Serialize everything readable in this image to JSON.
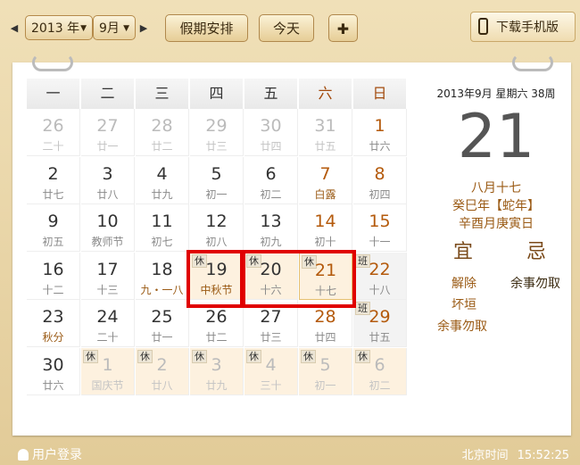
{
  "toolbar": {
    "year": "2013 年",
    "month": "9月",
    "holiday_btn": "假期安排",
    "today_btn": "今天",
    "add_btn": "✚",
    "mobile_btn": "下载手机版"
  },
  "weekdays": [
    "一",
    "二",
    "三",
    "四",
    "五",
    "六",
    "日"
  ],
  "weeks": [
    [
      {
        "d": "26",
        "s": "二十",
        "cls": "other"
      },
      {
        "d": "27",
        "s": "廿一",
        "cls": "other"
      },
      {
        "d": "28",
        "s": "廿二",
        "cls": "other"
      },
      {
        "d": "29",
        "s": "廿三",
        "cls": "other"
      },
      {
        "d": "30",
        "s": "廿四",
        "cls": "other"
      },
      {
        "d": "31",
        "s": "廿五",
        "cls": "other"
      },
      {
        "d": "1",
        "s": "廿六",
        "cls": "weekend"
      }
    ],
    [
      {
        "d": "2",
        "s": "廿七"
      },
      {
        "d": "3",
        "s": "廿八"
      },
      {
        "d": "4",
        "s": "廿九"
      },
      {
        "d": "5",
        "s": "初一"
      },
      {
        "d": "6",
        "s": "初二"
      },
      {
        "d": "7",
        "s": "白露",
        "cls": "weekend festival"
      },
      {
        "d": "8",
        "s": "初四",
        "cls": "weekend"
      }
    ],
    [
      {
        "d": "9",
        "s": "初五"
      },
      {
        "d": "10",
        "s": "教师节"
      },
      {
        "d": "11",
        "s": "初七"
      },
      {
        "d": "12",
        "s": "初八"
      },
      {
        "d": "13",
        "s": "初九"
      },
      {
        "d": "14",
        "s": "初十",
        "cls": "weekend"
      },
      {
        "d": "15",
        "s": "十一",
        "cls": "weekend"
      }
    ],
    [
      {
        "d": "16",
        "s": "十二"
      },
      {
        "d": "17",
        "s": "十三"
      },
      {
        "d": "18",
        "s": "九・一八",
        "cls": "festival"
      },
      {
        "d": "19",
        "s": "中秋节",
        "cls": "holiday festival",
        "tag": "休"
      },
      {
        "d": "20",
        "s": "十六",
        "cls": "holiday",
        "tag": "休"
      },
      {
        "d": "21",
        "s": "十七",
        "cls": "holiday weekend today",
        "tag": "休"
      },
      {
        "d": "22",
        "s": "十八",
        "cls": "shade weekend",
        "tag": "班"
      }
    ],
    [
      {
        "d": "23",
        "s": "秋分",
        "cls": "festival"
      },
      {
        "d": "24",
        "s": "二十"
      },
      {
        "d": "25",
        "s": "廿一"
      },
      {
        "d": "26",
        "s": "廿二"
      },
      {
        "d": "27",
        "s": "廿三"
      },
      {
        "d": "28",
        "s": "廿四",
        "cls": "weekend"
      },
      {
        "d": "29",
        "s": "廿五",
        "cls": "shade weekend",
        "tag": "班"
      }
    ],
    [
      {
        "d": "30",
        "s": "廿六"
      },
      {
        "d": "1",
        "s": "国庆节",
        "cls": "other holiday",
        "tag": "休"
      },
      {
        "d": "2",
        "s": "廿八",
        "cls": "other holiday",
        "tag": "休"
      },
      {
        "d": "3",
        "s": "廿九",
        "cls": "other holiday",
        "tag": "休"
      },
      {
        "d": "4",
        "s": "三十",
        "cls": "other holiday",
        "tag": "休"
      },
      {
        "d": "5",
        "s": "初一",
        "cls": "other holiday",
        "tag": "休"
      },
      {
        "d": "6",
        "s": "初二",
        "cls": "other holiday",
        "tag": "休"
      }
    ]
  ],
  "panel": {
    "year_month": "2013年9月  星期六  38周",
    "day": "21",
    "lunar": "八月十七",
    "ganzhi_year": "癸巳年【蛇年】",
    "ganzhi_day": "辛酉月庚寅日",
    "yi": "宜",
    "ji": "忌",
    "yi_items": [
      "解除",
      "坏垣",
      "余事勿取"
    ],
    "ji_items": [
      "余事勿取"
    ]
  },
  "footer": {
    "login": "用户登录",
    "time_label": "北京时间",
    "time": "15:52:25"
  },
  "colors": {
    "accent": "#b45a0c",
    "highlight": "#e00000",
    "holiday_bg": "#fdf1df"
  }
}
